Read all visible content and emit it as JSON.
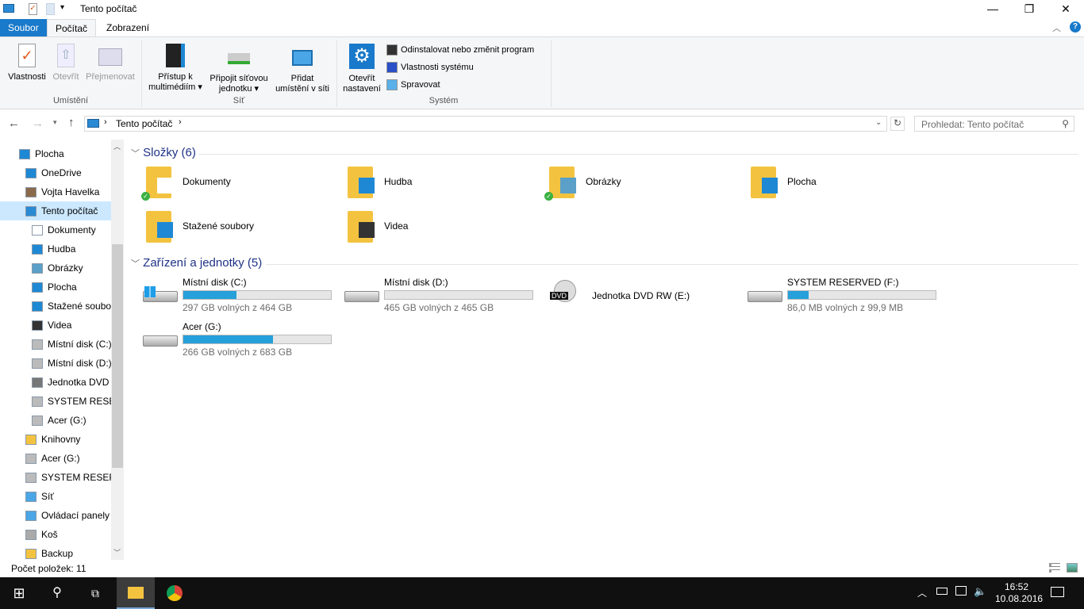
{
  "window": {
    "title": "Tento počítač",
    "minimize": "—",
    "maximize": "❐",
    "close": "✕"
  },
  "ribbon": {
    "tabs": [
      "Soubor",
      "Počítač",
      "Zobrazení"
    ],
    "location": {
      "group": "Umístění",
      "buttons": [
        "Vlastnosti",
        "Otevřít",
        "Přejmenovat"
      ]
    },
    "network": {
      "group": "Síť",
      "buttons": [
        [
          "Přístup k",
          "multimédiím ▾"
        ],
        [
          "Připojit síťovou",
          "jednotku ▾"
        ],
        [
          "Přidat",
          "umístění v síti"
        ]
      ]
    },
    "system": {
      "group": "Systém",
      "open_settings": [
        "Otevřít",
        "nastavení"
      ],
      "items": [
        "Odinstalovat nebo změnit program",
        "Vlastnosti systému",
        "Spravovat"
      ]
    }
  },
  "address": {
    "path": "Tento počítač",
    "search_placeholder": "Prohledat: Tento počítač"
  },
  "nav": [
    {
      "label": "Plocha",
      "indent": 0,
      "icon": "desktop"
    },
    {
      "label": "OneDrive",
      "indent": 1,
      "icon": "cloud"
    },
    {
      "label": "Vojta Havelka",
      "indent": 1,
      "icon": "user"
    },
    {
      "label": "Tento počítač",
      "indent": 1,
      "icon": "pc",
      "selected": true
    },
    {
      "label": "Dokumenty",
      "indent": 2,
      "icon": "doc"
    },
    {
      "label": "Hudba",
      "indent": 2,
      "icon": "music"
    },
    {
      "label": "Obrázky",
      "indent": 2,
      "icon": "pic"
    },
    {
      "label": "Plocha",
      "indent": 2,
      "icon": "desktop"
    },
    {
      "label": "Stažené soubory",
      "indent": 2,
      "icon": "down"
    },
    {
      "label": "Videa",
      "indent": 2,
      "icon": "video"
    },
    {
      "label": "Místní disk (C:)",
      "indent": 2,
      "icon": "disk"
    },
    {
      "label": "Místní disk (D:)",
      "indent": 2,
      "icon": "disk"
    },
    {
      "label": "Jednotka DVD RW (E:)",
      "indent": 2,
      "icon": "dvd"
    },
    {
      "label": "SYSTEM RESERVED (F:)",
      "indent": 2,
      "icon": "disk"
    },
    {
      "label": "Acer (G:)",
      "indent": 2,
      "icon": "disk"
    },
    {
      "label": "Knihovny",
      "indent": 1,
      "icon": "lib"
    },
    {
      "label": "Acer (G:)",
      "indent": 1,
      "icon": "disk"
    },
    {
      "label": "SYSTEM RESERVED (F:)",
      "indent": 1,
      "icon": "disk"
    },
    {
      "label": "Síť",
      "indent": 1,
      "icon": "net"
    },
    {
      "label": "Ovládací panely",
      "indent": 1,
      "icon": "cp"
    },
    {
      "label": "Koš",
      "indent": 1,
      "icon": "bin"
    },
    {
      "label": "Backup",
      "indent": 1,
      "icon": "folder"
    }
  ],
  "folders": {
    "header": "Složky (6)",
    "items": [
      {
        "label": "Dokumenty",
        "synced": true,
        "overlay": "doc"
      },
      {
        "label": "Hudba",
        "synced": false,
        "overlay": "music"
      },
      {
        "label": "Obrázky",
        "synced": true,
        "overlay": "pic"
      },
      {
        "label": "Plocha",
        "synced": false,
        "overlay": "desktop"
      },
      {
        "label": "Stažené soubory",
        "synced": false,
        "overlay": "down"
      },
      {
        "label": "Videa",
        "synced": false,
        "overlay": "video"
      }
    ]
  },
  "drives": {
    "header": "Zařízení a jednotky (5)",
    "items": [
      {
        "name": "Místní disk (C:)",
        "free": "297 GB volných z 464 GB",
        "used_fraction": 0.36,
        "type": "win"
      },
      {
        "name": "Místní disk (D:)",
        "free": "465 GB volných z 465 GB",
        "used_fraction": 0.0,
        "type": "disk"
      },
      {
        "name": "Jednotka DVD RW (E:)",
        "type": "dvd",
        "badge": "DVD"
      },
      {
        "name": "SYSTEM RESERVED (F:)",
        "free": "86,0 MB volných z 99,9 MB",
        "used_fraction": 0.14,
        "type": "disk"
      },
      {
        "name": "Acer (G:)",
        "free": "266 GB volných z 683 GB",
        "used_fraction": 0.61,
        "type": "disk"
      }
    ]
  },
  "status": "Počet položek: 11",
  "taskbar": {
    "time": "16:52",
    "date": "10.08.2016"
  },
  "colors": {
    "accent": "#1979ca",
    "bar": "#26a0da",
    "selected": "#cce8ff"
  }
}
